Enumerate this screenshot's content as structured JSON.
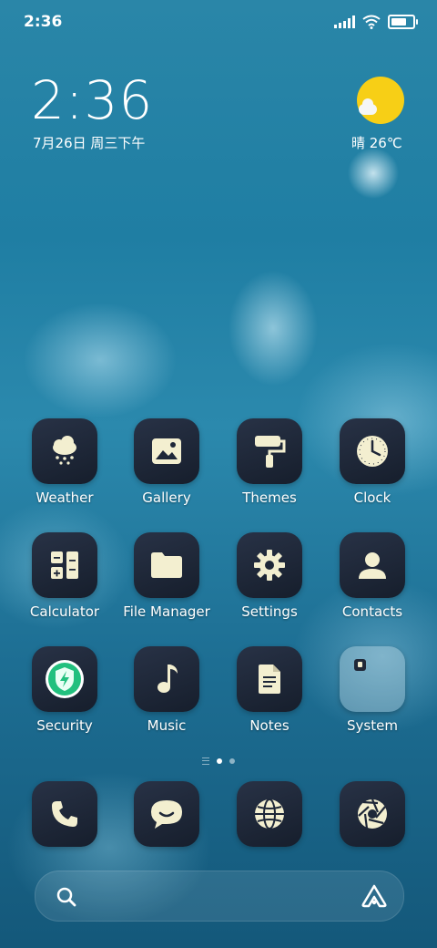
{
  "status_bar": {
    "time": "2:36",
    "battery_level": 0.9
  },
  "lockclock": {
    "time": "2:36",
    "date": "7月26日 周三下午"
  },
  "weather_widget": {
    "text": "晴 26℃",
    "icon": "sun-cloud-icon",
    "colors": {
      "sun": "#f7cf16",
      "cloud": "#f5f6f6"
    }
  },
  "apps": [
    {
      "label": "Weather",
      "icon": "weather-rain-cloud-icon"
    },
    {
      "label": "Gallery",
      "icon": "image-icon"
    },
    {
      "label": "Themes",
      "icon": "paint-roller-icon"
    },
    {
      "label": "Clock",
      "icon": "clock-icon"
    },
    {
      "label": "Calculator",
      "icon": "calculator-icon"
    },
    {
      "label": "File Manager",
      "icon": "folder-icon"
    },
    {
      "label": "Settings",
      "icon": "gear-icon"
    },
    {
      "label": "Contacts",
      "icon": "person-icon"
    },
    {
      "label": "Security",
      "icon": "shield-bolt-icon"
    },
    {
      "label": "Music",
      "icon": "music-note-icon"
    },
    {
      "label": "Notes",
      "icon": "document-icon"
    },
    {
      "label": "System",
      "icon": "folder-grid-icon"
    }
  ],
  "page_indicator": {
    "pages": 2,
    "current": 1
  },
  "dock": [
    {
      "icon": "phone-icon"
    },
    {
      "icon": "message-bubble-icon"
    },
    {
      "icon": "globe-icon"
    },
    {
      "icon": "camera-aperture-icon"
    }
  ],
  "search_bar": {
    "left_icon": "search-icon",
    "right_icon": "assistant-icon"
  },
  "colors": {
    "icon_bg_top": "#283246",
    "icon_bg_bottom": "#161e2c",
    "glyph": "#f3efd0",
    "security_green": "#22c07e"
  }
}
